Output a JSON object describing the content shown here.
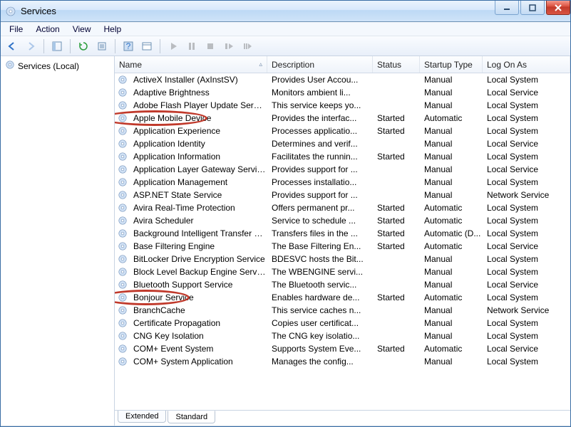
{
  "window": {
    "title": "Services"
  },
  "menubar": {
    "file": "File",
    "action": "Action",
    "view": "View",
    "help": "Help"
  },
  "leftpane": {
    "root": "Services (Local)"
  },
  "columns": {
    "name": "Name",
    "description": "Description",
    "status": "Status",
    "startup": "Startup Type",
    "logon": "Log On As"
  },
  "rows": [
    {
      "name": "ActiveX Installer (AxInstSV)",
      "desc": "Provides User Accou...",
      "status": "",
      "startup": "Manual",
      "logon": "Local System"
    },
    {
      "name": "Adaptive Brightness",
      "desc": "Monitors ambient li...",
      "status": "",
      "startup": "Manual",
      "logon": "Local Service"
    },
    {
      "name": "Adobe Flash Player Update Service",
      "desc": "This service keeps yo...",
      "status": "",
      "startup": "Manual",
      "logon": "Local System"
    },
    {
      "name": "Apple Mobile Device",
      "desc": "Provides the interfac...",
      "status": "Started",
      "startup": "Automatic",
      "logon": "Local System",
      "circled": true
    },
    {
      "name": "Application Experience",
      "desc": "Processes applicatio...",
      "status": "Started",
      "startup": "Manual",
      "logon": "Local System"
    },
    {
      "name": "Application Identity",
      "desc": "Determines and verif...",
      "status": "",
      "startup": "Manual",
      "logon": "Local Service"
    },
    {
      "name": "Application Information",
      "desc": "Facilitates the runnin...",
      "status": "Started",
      "startup": "Manual",
      "logon": "Local System"
    },
    {
      "name": "Application Layer Gateway Service",
      "desc": "Provides support for ...",
      "status": "",
      "startup": "Manual",
      "logon": "Local Service"
    },
    {
      "name": "Application Management",
      "desc": "Processes installatio...",
      "status": "",
      "startup": "Manual",
      "logon": "Local System"
    },
    {
      "name": "ASP.NET State Service",
      "desc": "Provides support for ...",
      "status": "",
      "startup": "Manual",
      "logon": "Network Service"
    },
    {
      "name": "Avira Real-Time Protection",
      "desc": "Offers permanent pr...",
      "status": "Started",
      "startup": "Automatic",
      "logon": "Local System"
    },
    {
      "name": "Avira Scheduler",
      "desc": "Service to schedule ...",
      "status": "Started",
      "startup": "Automatic",
      "logon": "Local System"
    },
    {
      "name": "Background Intelligent Transfer Service",
      "desc": "Transfers files in the ...",
      "status": "Started",
      "startup": "Automatic (D...",
      "logon": "Local System"
    },
    {
      "name": "Base Filtering Engine",
      "desc": "The Base Filtering En...",
      "status": "Started",
      "startup": "Automatic",
      "logon": "Local Service"
    },
    {
      "name": "BitLocker Drive Encryption Service",
      "desc": "BDESVC hosts the Bit...",
      "status": "",
      "startup": "Manual",
      "logon": "Local System"
    },
    {
      "name": "Block Level Backup Engine Service",
      "desc": "The WBENGINE servi...",
      "status": "",
      "startup": "Manual",
      "logon": "Local System"
    },
    {
      "name": "Bluetooth Support Service",
      "desc": "The Bluetooth servic...",
      "status": "",
      "startup": "Manual",
      "logon": "Local Service"
    },
    {
      "name": "Bonjour Service",
      "desc": "Enables hardware de...",
      "status": "Started",
      "startup": "Automatic",
      "logon": "Local System",
      "circled": true
    },
    {
      "name": "BranchCache",
      "desc": "This service caches n...",
      "status": "",
      "startup": "Manual",
      "logon": "Network Service"
    },
    {
      "name": "Certificate Propagation",
      "desc": "Copies user certificat...",
      "status": "",
      "startup": "Manual",
      "logon": "Local System"
    },
    {
      "name": "CNG Key Isolation",
      "desc": "The CNG key isolatio...",
      "status": "",
      "startup": "Manual",
      "logon": "Local System"
    },
    {
      "name": "COM+ Event System",
      "desc": "Supports System Eve...",
      "status": "Started",
      "startup": "Automatic",
      "logon": "Local Service"
    },
    {
      "name": "COM+ System Application",
      "desc": "Manages the config...",
      "status": "",
      "startup": "Manual",
      "logon": "Local System"
    }
  ],
  "tabs": {
    "extended": "Extended",
    "standard": "Standard"
  }
}
